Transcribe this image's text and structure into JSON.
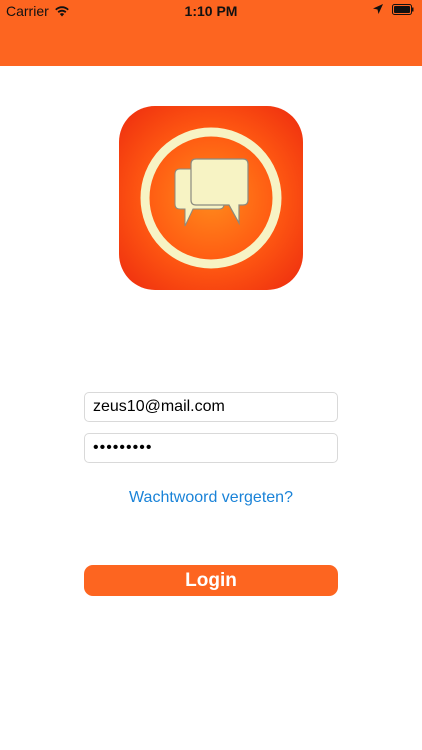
{
  "status_bar": {
    "carrier": "Carrier",
    "time": "1:10 PM"
  },
  "login_form": {
    "email_value": "zeus10@mail.com",
    "password_value": "•••••••••",
    "forgot_password_label": "Wachtwoord vergeten?",
    "login_label": "Login"
  },
  "colors": {
    "accent": "#fd6520",
    "link": "#1a83d8"
  },
  "icons": [
    "wifi-icon",
    "location-arrow-icon",
    "battery-icon",
    "chat-bubbles-icon"
  ]
}
